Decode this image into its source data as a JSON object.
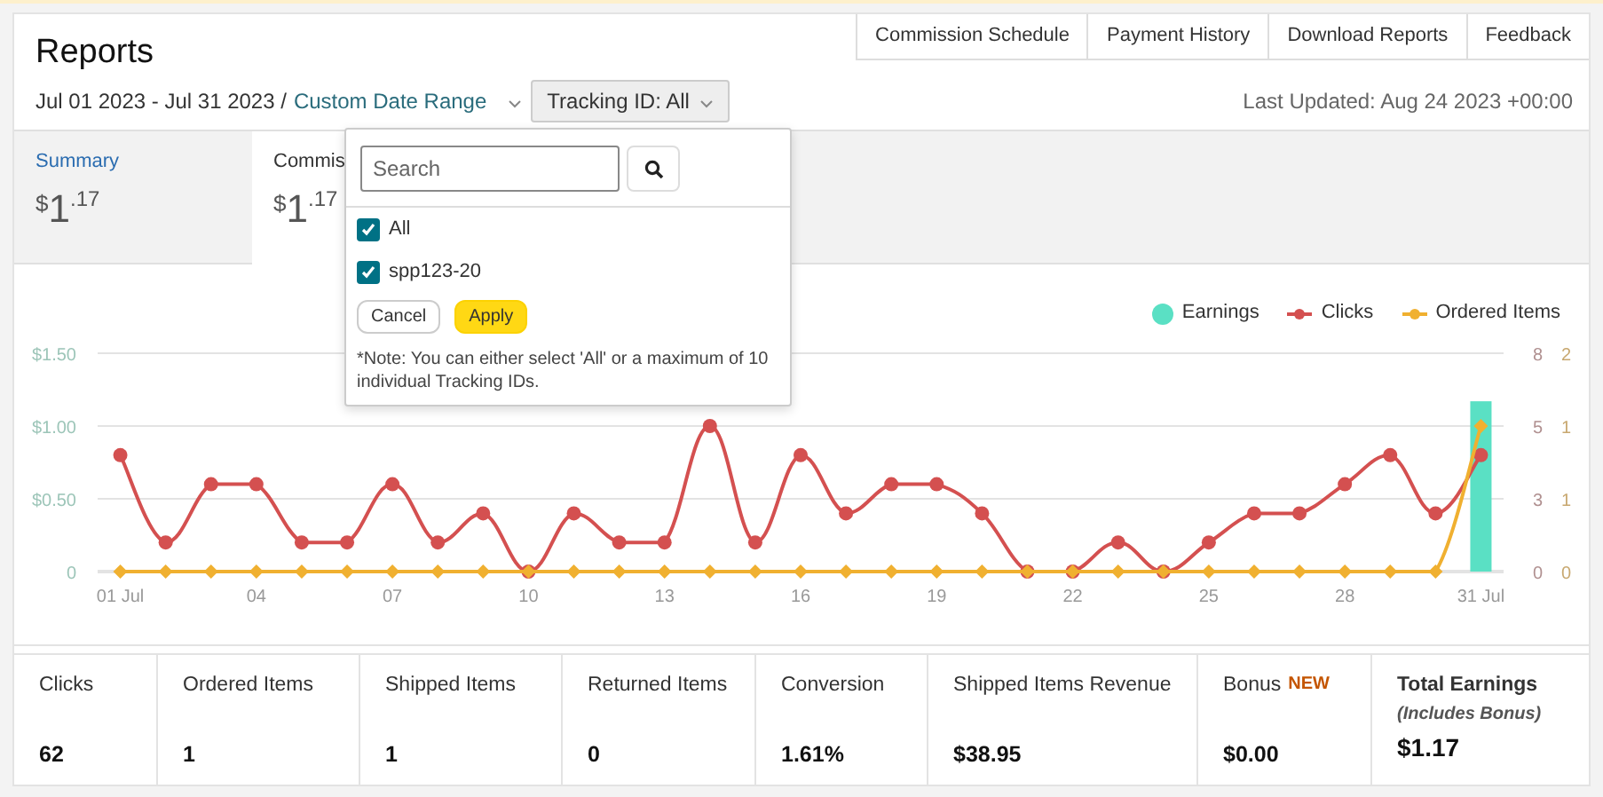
{
  "header": {
    "title": "Reports",
    "links": [
      "Commission Schedule",
      "Payment History",
      "Download Reports",
      "Feedback"
    ]
  },
  "date_range": {
    "dates": "Jul 01 2023 - Jul 31 2023 /",
    "range_link": "Custom Date Range"
  },
  "tracking_filter": {
    "label": "Tracking ID: All",
    "expanded": true
  },
  "last_updated": "Last Updated: Aug 24 2023 +00:00",
  "summary_tabs": [
    {
      "label": "Summary",
      "selected": false,
      "amount": {
        "currency": "$",
        "whole": "1",
        "cents": ".17"
      }
    },
    {
      "label": "Commis",
      "selected": true,
      "amount": {
        "currency": "$",
        "whole": "1",
        "cents": ".17"
      }
    }
  ],
  "tracking_dropdown": {
    "search_placeholder": "Search",
    "options": [
      {
        "label": "All",
        "checked": true
      },
      {
        "label": "spp123-20",
        "checked": true
      }
    ],
    "buttons": [
      {
        "label": "Cancel",
        "kind": "secondary"
      },
      {
        "label": "Apply",
        "kind": "primary"
      }
    ],
    "note": "*Note: You can either select 'All' or a maximum of 10 individual Tracking IDs."
  },
  "chart": {
    "chart_data": {
      "type": "line",
      "x": [
        1,
        2,
        3,
        4,
        5,
        6,
        7,
        8,
        9,
        10,
        11,
        12,
        13,
        14,
        15,
        16,
        17,
        18,
        19,
        20,
        21,
        22,
        23,
        24,
        25,
        26,
        27,
        28,
        29,
        30,
        31
      ],
      "xlim": [
        0.5,
        31.5
      ],
      "xticks": [
        {
          "value": 1,
          "label": "01 Jul"
        },
        {
          "value": 4,
          "label": "04"
        },
        {
          "value": 7,
          "label": "07"
        },
        {
          "value": 10,
          "label": "10"
        },
        {
          "value": 13,
          "label": "13"
        },
        {
          "value": 16,
          "label": "16"
        },
        {
          "value": 19,
          "label": "19"
        },
        {
          "value": 22,
          "label": "22"
        },
        {
          "value": 25,
          "label": "25"
        },
        {
          "value": 28,
          "label": "28"
        },
        {
          "value": 31,
          "label": "31 Jul"
        }
      ],
      "ylim": [
        0,
        1.5
      ],
      "yticks": [
        {
          "value": 0,
          "label": "0"
        },
        {
          "value": 0.5,
          "label": "$0.50"
        },
        {
          "value": 1,
          "label": "$1.00"
        },
        {
          "value": 1.5,
          "label": "$1.50"
        }
      ],
      "y2lim": [
        0,
        7.5
      ],
      "y2ticks": [
        {
          "value": 0,
          "label": "0"
        },
        {
          "value": 2.5,
          "label": "3"
        },
        {
          "value": 5,
          "label": "5"
        },
        {
          "value": 7.5,
          "label": "8"
        }
      ],
      "y3lim": [
        0,
        1.5
      ],
      "y3ticks": [
        {
          "value": 0,
          "label": "0"
        },
        {
          "value": 0.5,
          "label": "1"
        },
        {
          "value": 1,
          "label": "1"
        },
        {
          "value": 1.5,
          "label": "2"
        }
      ],
      "series": [
        {
          "name": "Earnings",
          "color": "#5ae0c4",
          "type": "bar",
          "axis": "y",
          "values": [
            null,
            null,
            null,
            null,
            null,
            null,
            null,
            null,
            null,
            null,
            null,
            null,
            null,
            null,
            null,
            null,
            null,
            null,
            null,
            null,
            null,
            null,
            null,
            null,
            null,
            null,
            null,
            null,
            null,
            null,
            1.17
          ]
        },
        {
          "name": "Clicks",
          "color": "#d45050",
          "type": "line",
          "marker": "circle",
          "axis": "y2",
          "values": [
            4,
            1,
            3,
            3,
            1,
            1,
            3,
            1,
            2,
            0,
            2,
            1,
            1,
            5,
            1,
            4,
            2,
            3,
            3,
            2,
            0,
            0,
            1,
            0,
            1,
            2,
            2,
            3,
            4,
            2,
            4
          ]
        },
        {
          "name": "Ordered Items",
          "color": "#f0b030",
          "type": "line",
          "marker": "diamond",
          "axis": "y3",
          "values": [
            0,
            0,
            0,
            0,
            0,
            0,
            0,
            0,
            0,
            0,
            0,
            0,
            0,
            0,
            0,
            0,
            0,
            0,
            0,
            0,
            0,
            0,
            0,
            0,
            0,
            0,
            0,
            0,
            0,
            0,
            1
          ]
        }
      ]
    }
  },
  "stats": [
    {
      "label": "Clicks",
      "value": "62",
      "kind": "plain"
    },
    {
      "label": "Ordered Items",
      "value": "1",
      "kind": "plain"
    },
    {
      "label": "Shipped Items",
      "value": "1",
      "kind": "plain"
    },
    {
      "label": "Returned Items",
      "value": "0",
      "kind": "plain"
    },
    {
      "label": "Conversion",
      "value": "1.61%",
      "kind": "plain"
    },
    {
      "label": "Shipped Items Revenue",
      "value": "$38.95",
      "kind": "plain"
    },
    {
      "label": "Bonus",
      "badge": "NEW",
      "value": "$0.00",
      "kind": "plain"
    },
    {
      "label": "Total Earnings",
      "sublabel": "(Includes Bonus)",
      "value": "$1.17",
      "kind": "total"
    }
  ]
}
